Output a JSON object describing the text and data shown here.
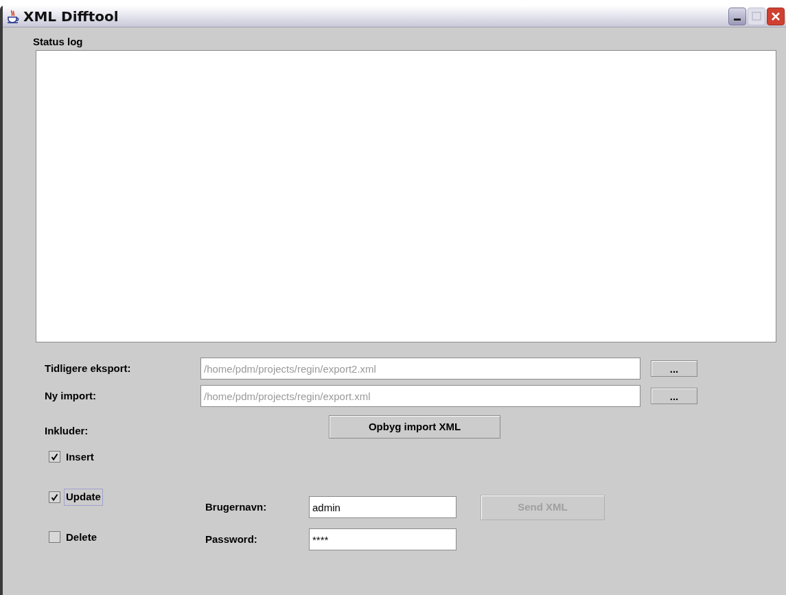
{
  "window": {
    "title": "XML Difftool"
  },
  "status_log": {
    "label": "Status log"
  },
  "files": [
    {
      "label": "Tidligere eksport:",
      "value": "/home/pdm/projects/regin/export2.xml",
      "disabled": true,
      "browse": "..."
    },
    {
      "label": "Ny import:",
      "value": "/home/pdm/projects/regin/export.xml",
      "disabled": true,
      "browse": "..."
    }
  ],
  "build_button": {
    "label": "Opbyg import XML",
    "disabled": false
  },
  "include": {
    "label": "Inkluder:",
    "options": [
      {
        "label": "Insert",
        "checked": true,
        "focused": false
      },
      {
        "label": "Update",
        "checked": true,
        "focused": true
      },
      {
        "label": "Delete",
        "checked": false,
        "focused": false
      }
    ]
  },
  "login": [
    {
      "label": "Brugernavn:",
      "value": "admin",
      "disabled": false
    },
    {
      "label": "Password:",
      "value": "****",
      "disabled": false
    }
  ],
  "send_button": {
    "label": "Send XML",
    "disabled": true
  }
}
